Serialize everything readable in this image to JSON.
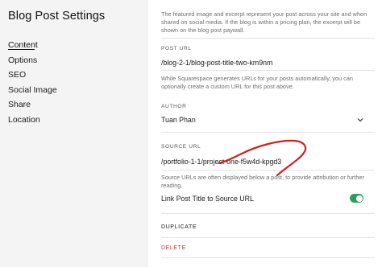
{
  "sidebar": {
    "title": "Blog Post Settings",
    "items": [
      {
        "label": "Content",
        "active": true
      },
      {
        "label": "Options"
      },
      {
        "label": "SEO"
      },
      {
        "label": "Social Image"
      },
      {
        "label": "Share"
      },
      {
        "label": "Location"
      }
    ]
  },
  "main": {
    "intro_text": "The featured image and excerpt represent your post across your site and when shared on social media. If the blog is within a pricing plan, the excerpt will be shown on the blog post paywall.",
    "post_url": {
      "label": "POST URL",
      "value": "/blog-2-1/blog-post-title-two-km9nm",
      "help": "While Squarespace generates URLs for your posts automatically, you can optionally create a custom URL for this post above."
    },
    "author": {
      "label": "AUTHOR",
      "value": "Tuan Phan"
    },
    "source_url": {
      "label": "SOURCE URL",
      "value": "/portfolio-1-1/project-one-f5w4d-kpgd3",
      "help": "Source URLs are often displayed below a post, to provide attribution or further reading."
    },
    "link_toggle": {
      "label": "Link Post Title to Source URL",
      "on": true
    },
    "duplicate_label": "DUPLICATE",
    "delete_label": "DELETE"
  },
  "colors": {
    "toggle_on": "#2e9e5b",
    "delete": "#d0342c",
    "annotation": "#d21f1f",
    "sidebar_bg": "#f4f4f4"
  },
  "icons": {
    "author_dropdown": "chevron-down-icon"
  }
}
